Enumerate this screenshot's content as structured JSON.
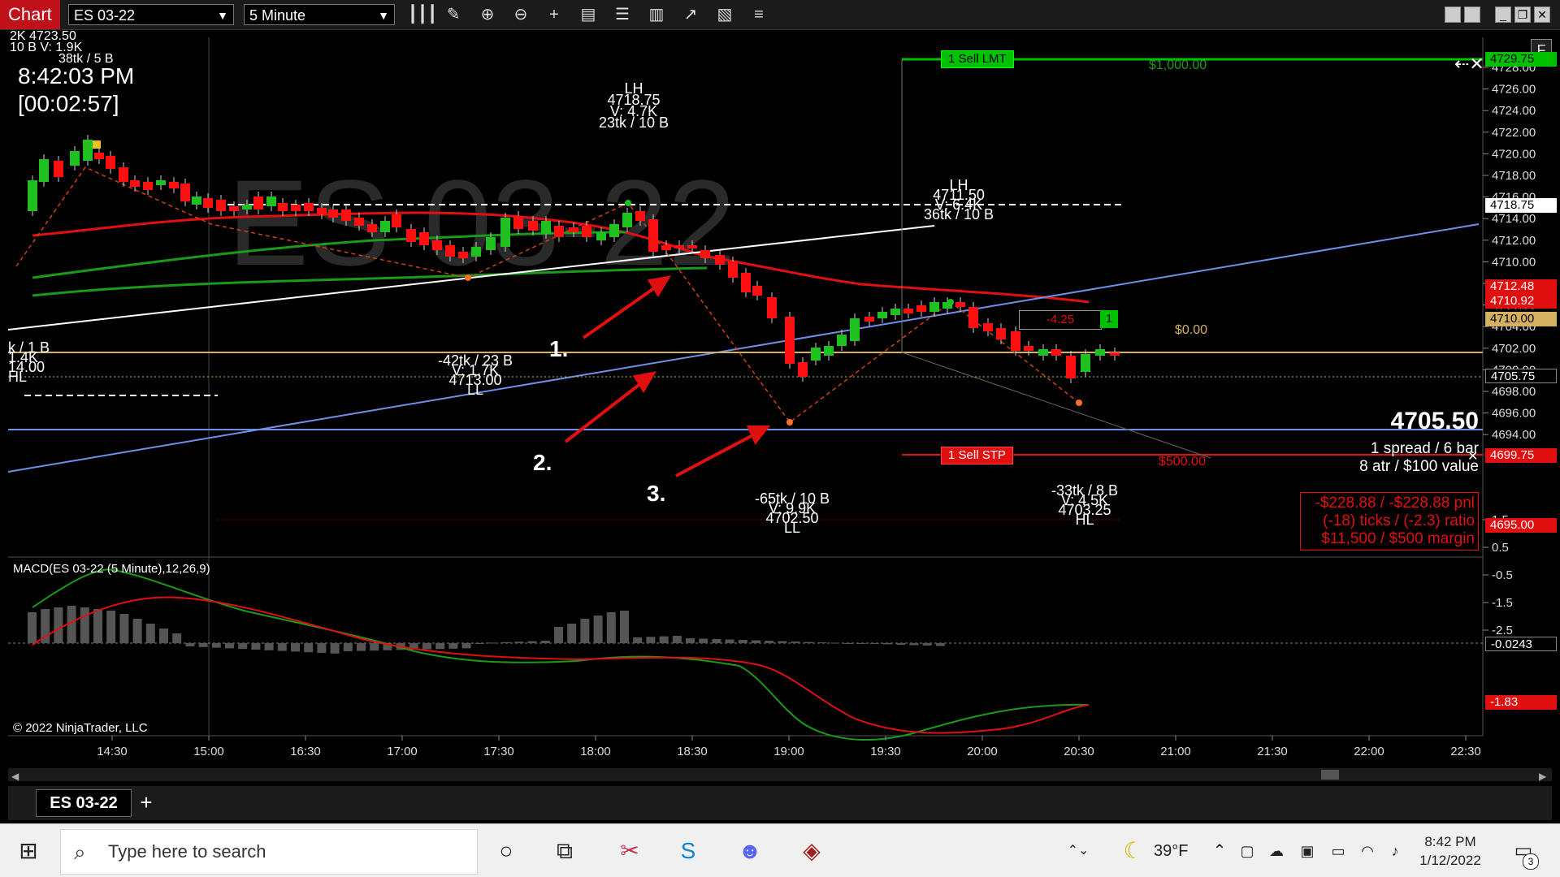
{
  "toolbar": {
    "title": "Chart",
    "instrument": "ES 03-22",
    "interval": "5 Minute",
    "tools": [
      "bar-style-icon",
      "draw-pencil-icon",
      "zoom-in-icon",
      "zoom-out-icon",
      "crosshair-icon",
      "data-box-icon",
      "properties-icon",
      "strategies-icon",
      "indicators-icon",
      "templates-icon",
      "menu-icon"
    ]
  },
  "watermark": "ES 03-22",
  "info": {
    "clock": "8:42:03 PM",
    "bar_timer": "[00:02:57]",
    "clipped_top_lines": [
      "2K   4723.50",
      "10 B    V: 1.9K",
      "38tk / 5 B"
    ]
  },
  "price_axis": {
    "ticks": [
      "4728.00",
      "4726.00",
      "4724.00",
      "4722.00",
      "4720.00",
      "4718.00",
      "4716.00",
      "4714.00",
      "4712.00",
      "4710.00",
      "4708.00",
      "4706.00",
      "4704.00",
      "4702.00",
      "4700.00",
      "4698.00",
      "4696.00",
      "4694.00"
    ],
    "labels": [
      {
        "text": "4729.75",
        "bg": "#00c000",
        "color": "#000"
      },
      {
        "text": "4718.75",
        "bg": "#ffffff",
        "color": "#000"
      },
      {
        "text": "4712.48",
        "bg": "#e01010",
        "color": "#fff"
      },
      {
        "text": "4710.92",
        "bg": "#e01010",
        "color": "#fff"
      },
      {
        "text": "4710.00",
        "bg": "#d4b060",
        "color": "#000"
      },
      {
        "text": "4705.75",
        "bg": "#000000",
        "color": "#fff"
      },
      {
        "text": "4699.75",
        "bg": "#e01010",
        "color": "#fff"
      },
      {
        "text": "4695.00",
        "bg": "#e01010",
        "color": "#fff"
      }
    ]
  },
  "orders": {
    "sell_lmt": "1 Sell LMT",
    "sell_lmt_value": "$1,000.00",
    "sell_stp": "1 Sell STP",
    "sell_stp_value": "$500.00",
    "position_pnl": "-4.25",
    "position_qty": "1",
    "position_value": "$0.00"
  },
  "stats": {
    "last_price": "4705.50",
    "spread": "1 spread / 6 bar",
    "atr": "8 atr / $100 value",
    "pnl_lines": [
      "-$228.88 / -$228.88 pnl",
      "(-18) ticks / (-2.3) ratio",
      "$11,500 / $500 margin"
    ]
  },
  "swing_labels": [
    {
      "lines": [
        "LH",
        "4718.75",
        "V: 4.7K",
        "23tk / 10 B"
      ]
    },
    {
      "lines": [
        "LH",
        "4711.50",
        "V: 6.4K",
        "36tk / 10 B"
      ]
    },
    {
      "lines": [
        "-42tk / 23 B",
        "V: 1.7K",
        "4713.00",
        "LL"
      ]
    },
    {
      "lines": [
        "-65tk / 10 B",
        "V: 9.9K",
        "4702.50",
        "LL"
      ]
    },
    {
      "lines": [
        "-33tk / 8 B",
        "V: 4.5K",
        "4703.25",
        "HL"
      ]
    },
    {
      "lines": [
        "k / 1 B",
        "1.4K",
        "14.00",
        "HL"
      ]
    }
  ],
  "annotations": [
    "1.",
    "2.",
    "3."
  ],
  "macd": {
    "title": "MACD(ES 03-22 (5 Minute),12,26,9)",
    "ticks": [
      "1.5",
      "0.5",
      "-0.5",
      "-1.5",
      "-2.5"
    ],
    "labels": [
      {
        "text": "-0.0243",
        "bg": "#000000",
        "color": "#fff"
      },
      {
        "text": "-1.83",
        "bg": "#e01010",
        "color": "#fff"
      }
    ]
  },
  "copyright": "© 2022 NinjaTrader, LLC",
  "time_axis": [
    "14:30",
    "15:00",
    "16:30",
    "17:00",
    "17:30",
    "18:00",
    "18:30",
    "19:00",
    "19:30",
    "20:00",
    "20:30",
    "21:00",
    "21:30",
    "22:00",
    "22:30"
  ],
  "tab": {
    "label": "ES 03-22",
    "add": "+"
  },
  "taskbar": {
    "search_placeholder": "Type here to search",
    "weather": "39°F",
    "time": "8:42 PM",
    "date": "1/12/2022",
    "notifications": "3"
  },
  "colors": {
    "up": "#20c020",
    "down": "#ff1010",
    "sma_green": "#1a9a1a",
    "sma_red": "#e01010",
    "trend_blue": "#6f8fe8",
    "macd_green": "#1a9a1a",
    "macd_red": "#e01010"
  }
}
